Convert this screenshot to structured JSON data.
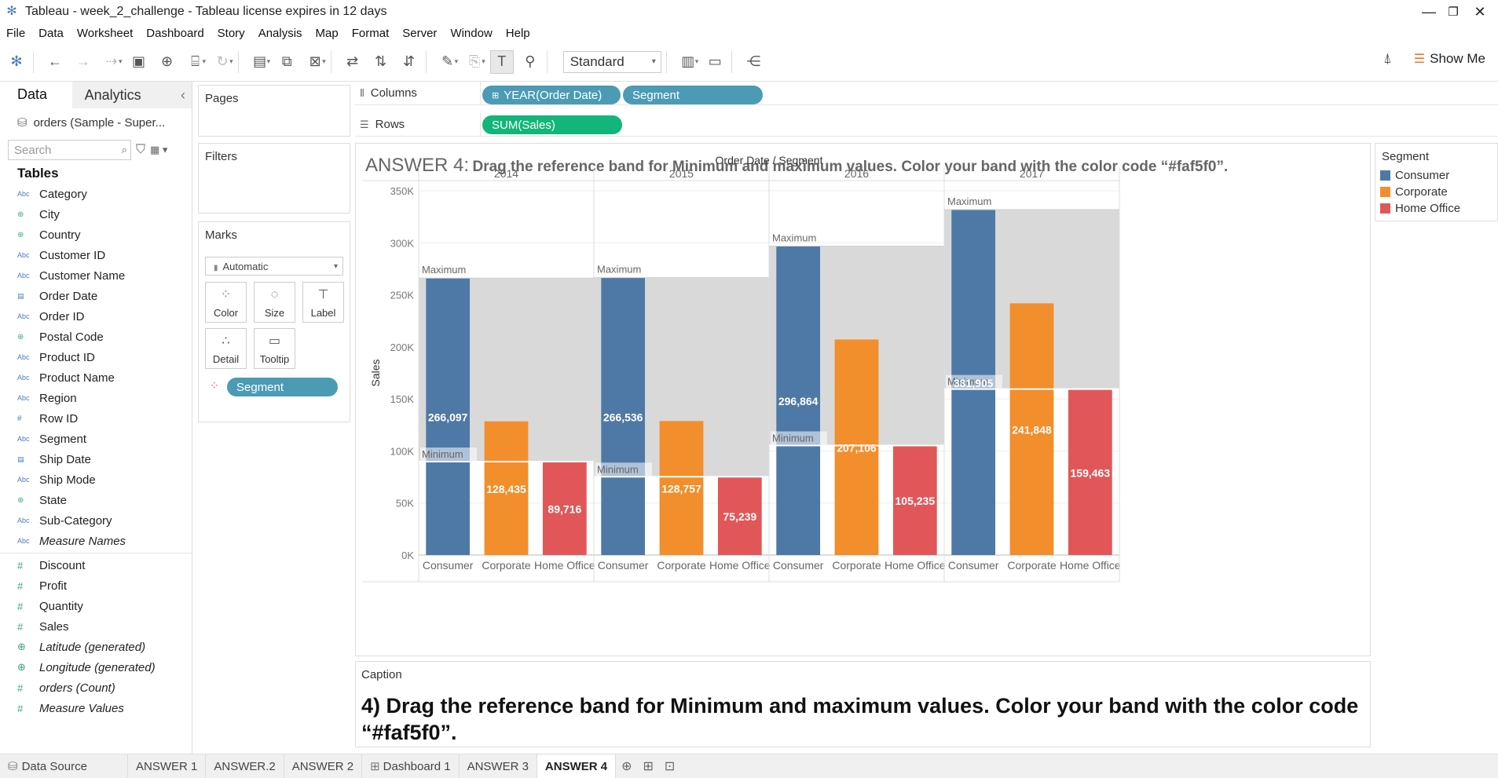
{
  "window": {
    "title": "Tableau - week_2_challenge - Tableau license expires in 12 days",
    "minimize": "—",
    "restore": "❐",
    "close": "✕"
  },
  "menu": [
    "File",
    "Data",
    "Worksheet",
    "Dashboard",
    "Story",
    "Analysis",
    "Map",
    "Format",
    "Server",
    "Window",
    "Help"
  ],
  "toolbar": {
    "fit_select": "Standard",
    "show_me": "Show Me"
  },
  "left_pane": {
    "tab_data": "Data",
    "tab_analytics": "Analytics",
    "collapse": "‹",
    "datasource": "orders (Sample - Super...",
    "search_placeholder": "Search",
    "tables_heading": "Tables",
    "dimensions": [
      {
        "name": "Category",
        "icon": "abc"
      },
      {
        "name": "City",
        "icon": "globe"
      },
      {
        "name": "Country",
        "icon": "globe"
      },
      {
        "name": "Customer ID",
        "icon": "abc"
      },
      {
        "name": "Customer Name",
        "icon": "abc"
      },
      {
        "name": "Order Date",
        "icon": "calendar"
      },
      {
        "name": "Order ID",
        "icon": "abc"
      },
      {
        "name": "Postal Code",
        "icon": "globe"
      },
      {
        "name": "Product ID",
        "icon": "abc"
      },
      {
        "name": "Product Name",
        "icon": "abc"
      },
      {
        "name": "Region",
        "icon": "abc"
      },
      {
        "name": "Row ID",
        "icon": "hash"
      },
      {
        "name": "Segment",
        "icon": "abc"
      },
      {
        "name": "Ship Date",
        "icon": "calendar"
      },
      {
        "name": "Ship Mode",
        "icon": "abc"
      },
      {
        "name": "State",
        "icon": "globe"
      },
      {
        "name": "Sub-Category",
        "icon": "abc"
      },
      {
        "name": "Measure Names",
        "icon": "abc"
      }
    ],
    "measures": [
      {
        "name": "Discount",
        "icon": "hash"
      },
      {
        "name": "Profit",
        "icon": "hash"
      },
      {
        "name": "Quantity",
        "icon": "hash"
      },
      {
        "name": "Sales",
        "icon": "hash"
      },
      {
        "name": "Latitude (generated)",
        "icon": "globe"
      },
      {
        "name": "Longitude (generated)",
        "icon": "globe"
      },
      {
        "name": "orders (Count)",
        "icon": "hash"
      },
      {
        "name": "Measure Values",
        "icon": "hash"
      }
    ]
  },
  "cards": {
    "pages": "Pages",
    "filters": "Filters",
    "marks": "Marks",
    "mark_type": "Automatic",
    "buttons": {
      "color": "Color",
      "size": "Size",
      "label": "Label",
      "detail": "Detail",
      "tooltip": "Tooltip"
    },
    "segment_pill": "Segment"
  },
  "shelves": {
    "columns_label": "Columns",
    "rows_label": "Rows",
    "columns": [
      "YEAR(Order Date)",
      "Segment"
    ],
    "rows": [
      "SUM(Sales)"
    ]
  },
  "viz": {
    "title_prefix": "ANSWER 4:",
    "title_rest": "Drag the reference band for Minimum and maximum values. Color your band with the color code “#faf5f0”.",
    "header": "Order Date / Segment",
    "band_max_label": "Maximum",
    "band_min_label": "Minimum"
  },
  "chart_data": {
    "type": "bar",
    "xlabel": "",
    "ylabel": "Sales",
    "ylim": [
      0,
      350000
    ],
    "yticks": [
      "0K",
      "50K",
      "100K",
      "150K",
      "200K",
      "250K",
      "300K",
      "350K"
    ],
    "years": [
      "2014",
      "2015",
      "2016",
      "2017"
    ],
    "categories": [
      "Consumer",
      "Corporate",
      "Home Office"
    ],
    "series": [
      {
        "year": "2014",
        "values": [
          266097,
          128435,
          89716
        ],
        "labels": [
          "266,097",
          "128,435",
          "89,716"
        ]
      },
      {
        "year": "2015",
        "values": [
          266536,
          128757,
          75239
        ],
        "labels": [
          "266,536",
          "128,757",
          "75,239"
        ]
      },
      {
        "year": "2016",
        "values": [
          296864,
          207106,
          105235
        ],
        "labels": [
          "296,864",
          "207,106",
          "105,235"
        ]
      },
      {
        "year": "2017",
        "values": [
          331905,
          241848,
          159463
        ],
        "labels": [
          "331,905",
          "241,848",
          "159,463"
        ]
      }
    ],
    "reference_band": {
      "from": "Minimum",
      "to": "Maximum",
      "per": "pane"
    },
    "colors": {
      "Consumer": "#4e79a7",
      "Corporate": "#f28e2b",
      "Home Office": "#e15759",
      "band": "#d9d9d9"
    }
  },
  "legend": {
    "title": "Segment",
    "items": [
      {
        "name": "Consumer",
        "color": "#4e79a7"
      },
      {
        "name": "Corporate",
        "color": "#f28e2b"
      },
      {
        "name": "Home Office",
        "color": "#e15759"
      }
    ]
  },
  "caption": {
    "heading": "Caption",
    "text": "4) Drag the reference band for Minimum and maximum values. Color your band with the color code “#faf5f0”."
  },
  "status_tabs": [
    "Data Source",
    "ANSWER 1",
    "ANSWER.2",
    "ANSWER 2",
    "Dashboard 1",
    "ANSWER 3",
    "ANSWER 4"
  ]
}
